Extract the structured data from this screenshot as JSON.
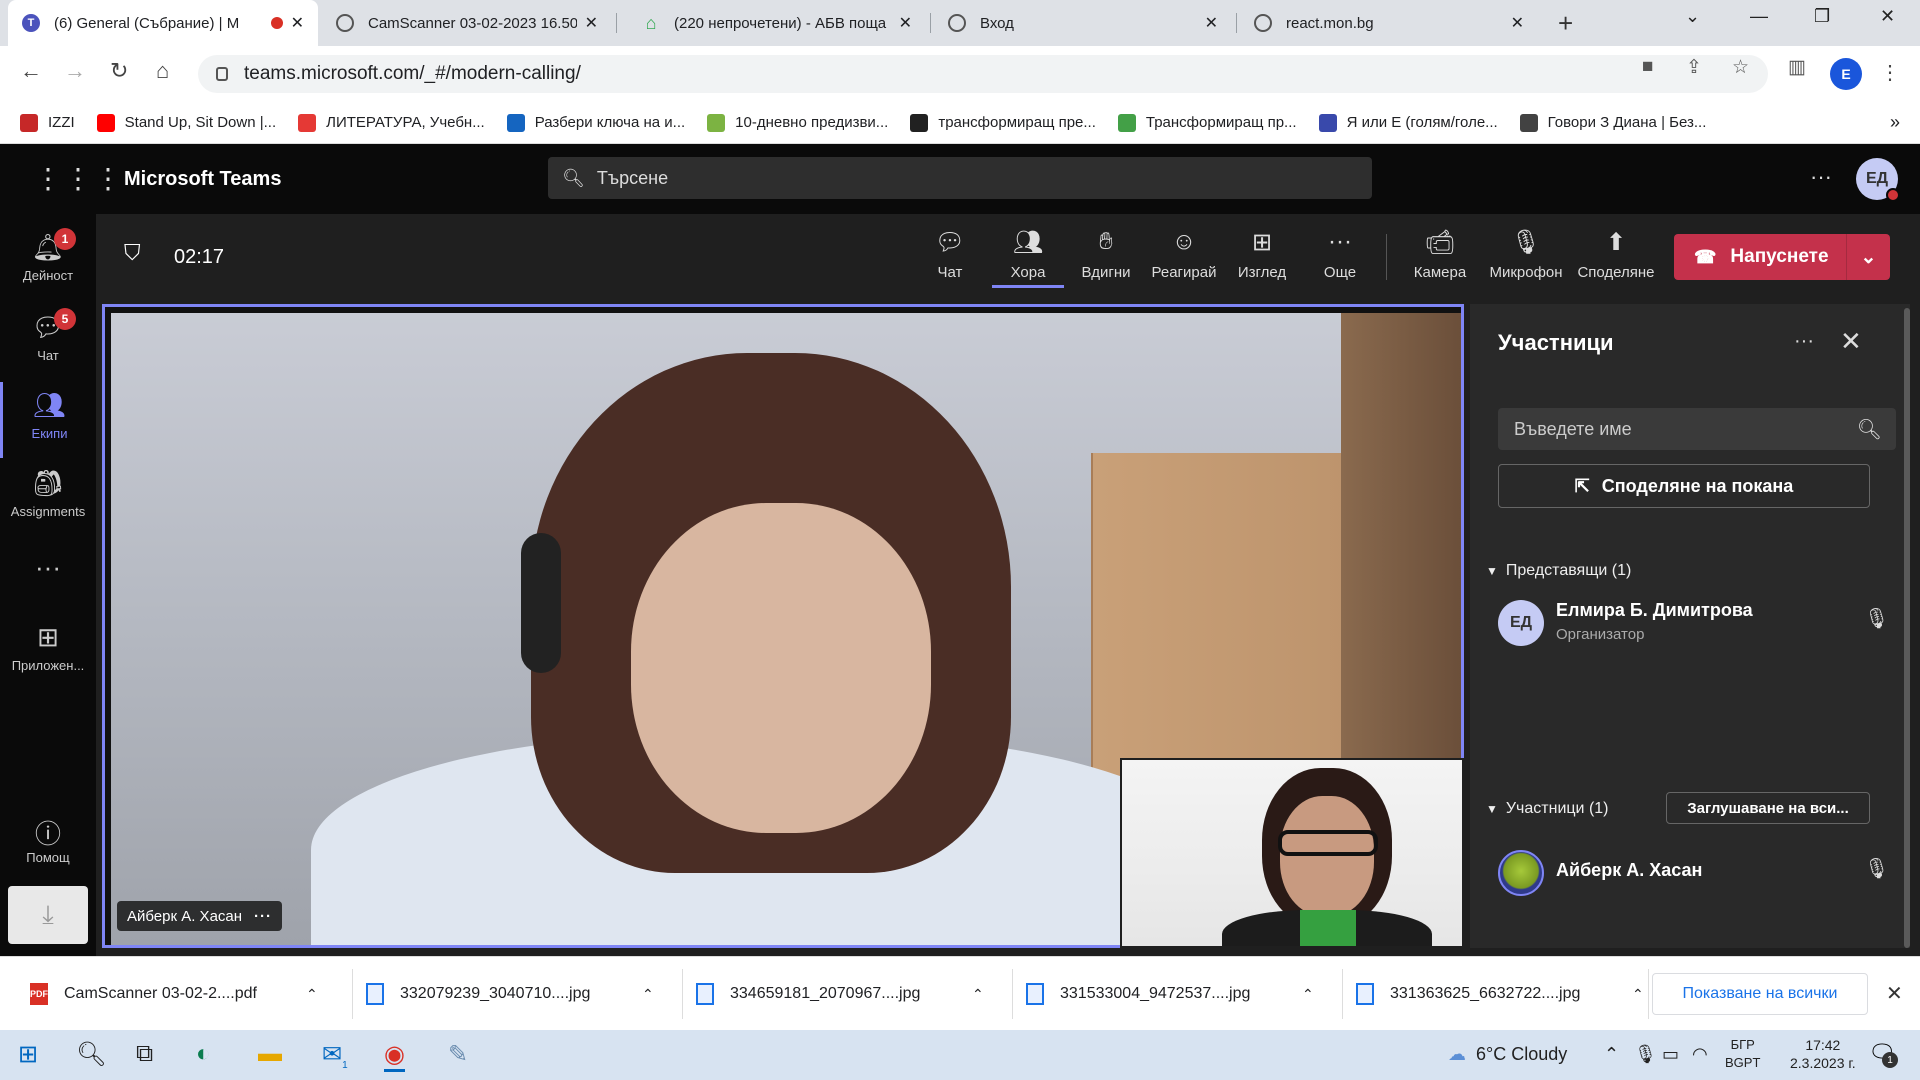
{
  "browser": {
    "tabs": [
      {
        "title": "(6) General (Събрание) | M",
        "active": true
      },
      {
        "title": "CamScanner 03-02-2023 16.50",
        "active": false
      },
      {
        "title": "(220 непрочетени) - АБВ поща",
        "active": false
      },
      {
        "title": "Вход",
        "active": false
      },
      {
        "title": "react.mon.bg",
        "active": false
      }
    ],
    "url": "teams.microsoft.com/_#/modern-calling/",
    "profile_initial": "E",
    "bookmarks": [
      {
        "label": "IZZI",
        "color": "#c62828"
      },
      {
        "label": "Stand Up, Sit Down |...",
        "color": "#ff0000"
      },
      {
        "label": "ЛИТЕРАТУРА, Учебн...",
        "color": "#e53935"
      },
      {
        "label": "Разбери ключа на и...",
        "color": "#1565c0"
      },
      {
        "label": "10-дневно предизви...",
        "color": "#7cb342"
      },
      {
        "label": "трансформиращ пре...",
        "color": "#212121"
      },
      {
        "label": "Трансформиращ пр...",
        "color": "#43a047"
      },
      {
        "label": "Я или Е (голям/голе...",
        "color": "#3949ab"
      },
      {
        "label": "Говори З Диана | Без...",
        "color": "#424242"
      }
    ]
  },
  "teams": {
    "brand": "Microsoft Teams",
    "search_placeholder": "Търсене",
    "avatar_initials": "ЕД",
    "rail": [
      {
        "label": "Дейност",
        "icon": "bell-icon",
        "badge": "1"
      },
      {
        "label": "Чат",
        "icon": "chat-icon",
        "badge": "5"
      },
      {
        "label": "Екипи",
        "icon": "teams-icon",
        "badge": ""
      },
      {
        "label": "Assignments",
        "icon": "assignments-icon",
        "badge": ""
      },
      {
        "label": "Приложен...",
        "icon": "apps-icon",
        "badge": ""
      },
      {
        "label": "Помощ",
        "icon": "help-icon",
        "badge": ""
      }
    ],
    "call": {
      "timer": "02:17",
      "buttons": [
        {
          "label": "Чат",
          "icon": "chat-icon"
        },
        {
          "label": "Хора",
          "icon": "people-icon"
        },
        {
          "label": "Вдигни",
          "icon": "raise-hand-icon"
        },
        {
          "label": "Реагирай",
          "icon": "react-icon"
        },
        {
          "label": "Изглед",
          "icon": "layout-icon"
        },
        {
          "label": "Още",
          "icon": "more-icon"
        },
        {
          "label": "Камера",
          "icon": "camera-icon"
        },
        {
          "label": "Микрофон",
          "icon": "mic-icon"
        },
        {
          "label": "Споделяне",
          "icon": "share-icon"
        }
      ],
      "leave_label": "Напуснете",
      "active_speaker": "Айберк А. Хасан"
    },
    "panel": {
      "title": "Участници",
      "search_placeholder": "Въведете име",
      "invite_label": "Споделяне на покана",
      "presenters_header": "Представящи (1)",
      "participants_header": "Участници (1)",
      "mute_all_label": "Заглушаване на вси...",
      "presenters": [
        {
          "initials": "ЕД",
          "name": "Елмира Б. Димитрова",
          "role": "Организатор"
        }
      ],
      "participants": [
        {
          "name": "Айберк А. Хасан"
        }
      ]
    }
  },
  "downloads": {
    "items": [
      {
        "name": "CamScanner 03-02-2....pdf",
        "type": "pdf"
      },
      {
        "name": "332079239_3040710....jpg",
        "type": "jpg"
      },
      {
        "name": "334659181_2070967....jpg",
        "type": "jpg"
      },
      {
        "name": "331533004_9472537....jpg",
        "type": "jpg"
      },
      {
        "name": "331363625_6632722....jpg",
        "type": "jpg"
      }
    ],
    "show_all_label": "Показване на всички"
  },
  "taskbar": {
    "weather": "6°C  Cloudy",
    "lang_top": "БГР",
    "lang_bottom": "BGPT",
    "time": "17:42",
    "date": "2.3.2023 г.",
    "notif_count": "1",
    "mail_badge": "1"
  }
}
